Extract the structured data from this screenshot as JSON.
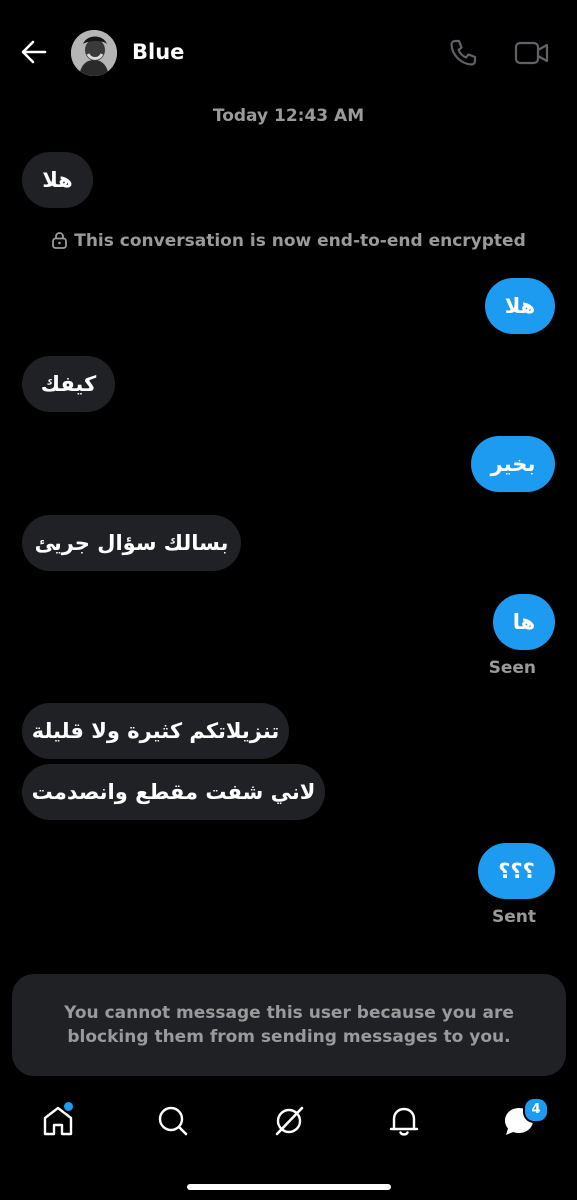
{
  "header": {
    "contact_name": "Blue",
    "icons": [
      "back-arrow-icon",
      "phone-icon",
      "video-camera-icon"
    ]
  },
  "conversation": {
    "timestamp": "Today 12:43 AM",
    "encryption_notice": "This conversation is now end-to-end encrypted",
    "messages": [
      {
        "direction": "received",
        "text": "هلا"
      },
      {
        "direction": "sent",
        "text": "هلا"
      },
      {
        "direction": "received",
        "text": "كيفك"
      },
      {
        "direction": "sent",
        "text": "بخير"
      },
      {
        "direction": "received",
        "text": "بسالك سؤال جريئ"
      },
      {
        "direction": "sent",
        "text": "ها",
        "status": "Seen"
      },
      {
        "direction": "received",
        "text": "تنزيلاتكم كثيرة ولا قليلة"
      },
      {
        "direction": "received",
        "text": "لاني شفت مقطع وانصدمت"
      },
      {
        "direction": "sent",
        "text": "؟؟؟",
        "status": "Sent"
      }
    ]
  },
  "blocked_notice": "You cannot message this user because you are blocking them from sending messages to you.",
  "bottom_nav": {
    "items": [
      "home-icon",
      "search-icon",
      "grok-icon",
      "notifications-icon",
      "messages-icon"
    ],
    "messages_badge": "4"
  },
  "colors": {
    "background": "#000000",
    "received_bubble": "#202124",
    "sent_bubble": "#1d9bf0",
    "muted_text": "#9a9a9a"
  }
}
